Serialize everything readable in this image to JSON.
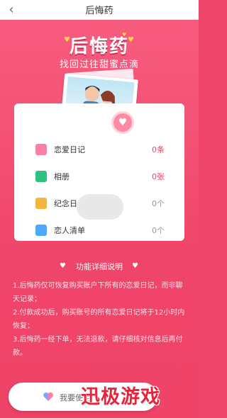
{
  "header": {
    "title": "后悔药",
    "back_icon": "back-arrow-icon"
  },
  "hero": {
    "title": "后悔药",
    "subtitle": "找回过往甜蜜点滴"
  },
  "records": [
    {
      "label": "恋爱日记",
      "value": "0条",
      "icon": "diary-icon",
      "color": "#ff7fa4"
    },
    {
      "label": "相册",
      "value": "0张",
      "icon": "album-icon",
      "color": "#2ec27e"
    },
    {
      "label": "纪念日",
      "value": "0个",
      "icon": "cake-icon",
      "color": "#f4b53f"
    },
    {
      "label": "恋人清单",
      "value": "0个",
      "icon": "checklist-icon",
      "color": "#4aa8ff"
    }
  ],
  "info": {
    "title": "功能详细说明",
    "lines": [
      "1.后悔药仅可恢复购买账户下所有的恋爱日记，而非聊天记录；",
      "2.付款成功后，购买账号的所有恋爱日记将于12小时内恢复；",
      "3.后悔药一经下单，无法退款，请仔细核对信息后再付款。"
    ]
  },
  "purchase": {
    "label": "我要使用"
  },
  "watermark": {
    "text": "迅极游戏"
  },
  "colors": {
    "accent": "#f0456a",
    "white": "#ffffff"
  }
}
